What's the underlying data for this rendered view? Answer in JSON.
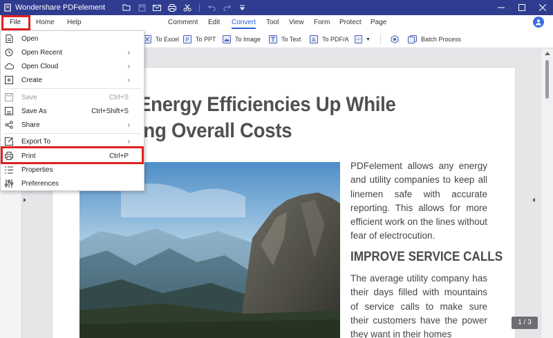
{
  "window": {
    "app_title": "Wondershare PDFelement"
  },
  "menubar": {
    "file": "File",
    "home": "Home",
    "help": "Help",
    "tabs": [
      "Comment",
      "Edit",
      "Convert",
      "Tool",
      "View",
      "Form",
      "Protect",
      "Page"
    ],
    "active_tab": "Convert"
  },
  "ribbon": {
    "items": [
      "To Excel",
      "To PPT",
      "To Image",
      "To Text",
      "To PDF/A",
      "Batch Process"
    ]
  },
  "file_menu": {
    "items": [
      {
        "label": "Open",
        "shortcut": "",
        "submenu": false,
        "disabled": false,
        "icon": "open-icon"
      },
      {
        "label": "Open Recent",
        "shortcut": "",
        "submenu": true,
        "disabled": false,
        "icon": "clock-icon"
      },
      {
        "label": "Open Cloud",
        "shortcut": "",
        "submenu": true,
        "disabled": false,
        "icon": "cloud-icon"
      },
      {
        "label": "Create",
        "shortcut": "",
        "submenu": true,
        "disabled": false,
        "icon": "create-icon"
      },
      {
        "label": "Save",
        "shortcut": "Ctrl+S",
        "submenu": false,
        "disabled": true,
        "icon": "save-icon"
      },
      {
        "label": "Save As",
        "shortcut": "Ctrl+Shift+S",
        "submenu": false,
        "disabled": false,
        "icon": "save-as-icon"
      },
      {
        "label": "Share",
        "shortcut": "",
        "submenu": true,
        "disabled": false,
        "icon": "share-icon"
      },
      {
        "label": "Export To",
        "shortcut": "",
        "submenu": true,
        "disabled": false,
        "icon": "export-icon"
      },
      {
        "label": "Print",
        "shortcut": "Ctrl+P",
        "submenu": false,
        "disabled": false,
        "icon": "print-icon"
      },
      {
        "label": "Properties",
        "shortcut": "",
        "submenu": false,
        "disabled": false,
        "icon": "properties-icon"
      },
      {
        "label": "Preferences",
        "shortcut": "",
        "submenu": false,
        "disabled": false,
        "icon": "preferences-icon"
      }
    ]
  },
  "document": {
    "headline_line1": "Energy Efficiencies Up While",
    "headline_line2": "ing Overall Costs",
    "body1": "PDFelement allows any energy and utility companies to keep all linemen safe with accurate reporting. This allows for more efficient work on the lines without fear of electrocution.",
    "subhead": "IMPROVE SERVICE CALLS",
    "body2": "The average utility company has their days filled with mountains of service calls to make sure their customers have the power they want in their homes"
  },
  "page_indicator": "1 / 3",
  "colors": {
    "titlebar": "#2f3c8f",
    "accent": "#2a5bd6",
    "highlight": "#e02020"
  }
}
